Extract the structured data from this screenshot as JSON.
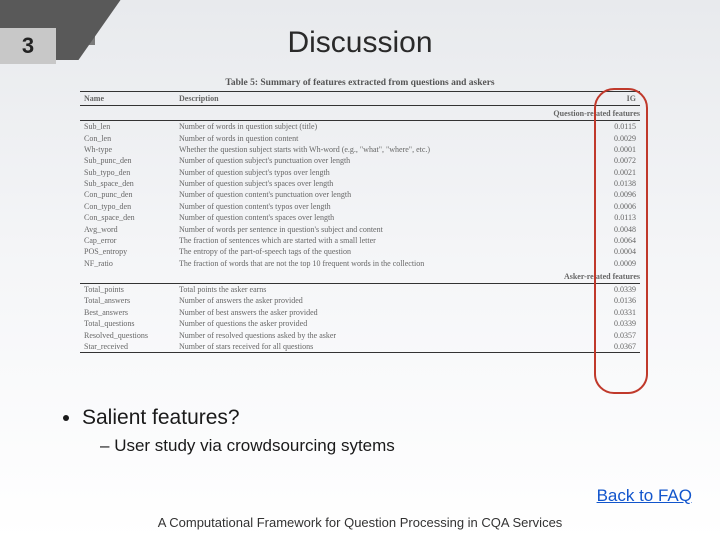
{
  "page_number": "3",
  "title": "Discussion",
  "table": {
    "caption": "Table 5: Summary of features extracted from questions and askers",
    "columns": [
      "Name",
      "Description",
      "IG"
    ],
    "section1_title": "Question-related features",
    "section2_title": "Asker-related features",
    "q_rows": [
      {
        "name": "Sub_len",
        "desc": "Number of words in question subject (title)",
        "ig": "0.0115"
      },
      {
        "name": "Con_len",
        "desc": "Number of words in question content",
        "ig": "0.0029"
      },
      {
        "name": "Wh-type",
        "desc": "Whether the question subject starts with Wh-word (e.g., \"what\", \"where\", etc.)",
        "ig": "0.0001"
      },
      {
        "name": "Sub_punc_den",
        "desc": "Number of question subject's punctuation over length",
        "ig": "0.0072"
      },
      {
        "name": "Sub_typo_den",
        "desc": "Number of question subject's typos over length",
        "ig": "0.0021"
      },
      {
        "name": "Sub_space_den",
        "desc": "Number of question subject's spaces over length",
        "ig": "0.0138"
      },
      {
        "name": "Con_punc_den",
        "desc": "Number of question content's punctuation over length",
        "ig": "0.0096"
      },
      {
        "name": "Con_typo_den",
        "desc": "Number of question content's typos over length",
        "ig": "0.0006"
      },
      {
        "name": "Con_space_den",
        "desc": "Number of question content's spaces over length",
        "ig": "0.0113"
      },
      {
        "name": "Avg_word",
        "desc": "Number of words per sentence in question's subject and content",
        "ig": "0.0048"
      },
      {
        "name": "Cap_error",
        "desc": "The fraction of sentences which are started with a small letter",
        "ig": "0.0064"
      },
      {
        "name": "POS_entropy",
        "desc": "The entropy of the part-of-speech tags of the question",
        "ig": "0.0004"
      },
      {
        "name": "NF_ratio",
        "desc": "The fraction of words that are not the top 10 frequent words in the collection",
        "ig": "0.0009"
      }
    ],
    "a_rows": [
      {
        "name": "Total_points",
        "desc": "Total points the asker earns",
        "ig": "0.0339"
      },
      {
        "name": "Total_answers",
        "desc": "Number of answers the asker provided",
        "ig": "0.0136"
      },
      {
        "name": "Best_answers",
        "desc": "Number of best answers the asker provided",
        "ig": "0.0331"
      },
      {
        "name": "Total_questions",
        "desc": "Number of questions the asker provided",
        "ig": "0.0339"
      },
      {
        "name": "Resolved_questions",
        "desc": "Number of resolved questions asked by the asker",
        "ig": "0.0357"
      },
      {
        "name": "Star_received",
        "desc": "Number of stars received for all questions",
        "ig": "0.0367"
      }
    ]
  },
  "bullet_main": "Salient features?",
  "bullet_sub": "User study via crowdsourcing sytems",
  "back_link": "Back to FAQ",
  "footer": "A Computational Framework for Question Processing in CQA Services"
}
